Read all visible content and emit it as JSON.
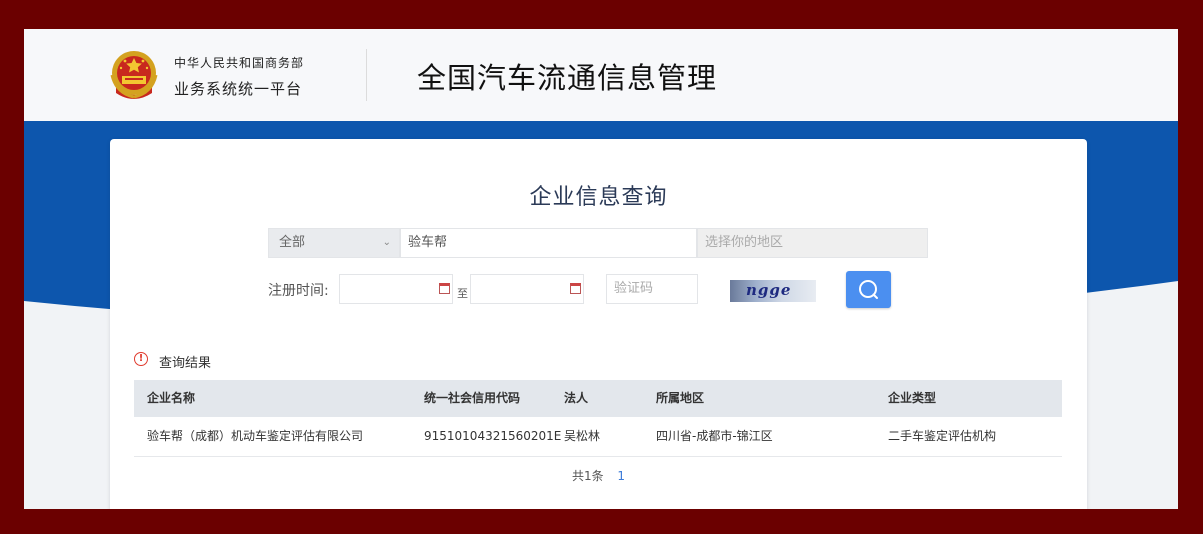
{
  "header": {
    "org_line1": "中华人民共和国商务部",
    "org_line2": "业务系统统一平台",
    "site_title": "全国汽车流通信息管理"
  },
  "search": {
    "title": "企业信息查询",
    "category_selected": "全部",
    "keyword_value": "验车帮",
    "region_placeholder": "选择你的地区",
    "reg_time_label": "注册时间:",
    "to_label": "至",
    "captcha_placeholder": "验证码",
    "captcha_text": "ngge"
  },
  "results": {
    "title": "查询结果",
    "columns": [
      "企业名称",
      "统一社会信用代码",
      "法人",
      "所属地区",
      "企业类型"
    ],
    "rows": [
      [
        "验车帮（成都）机动车鉴定评估有限公司",
        "91510104321560201E",
        "吴松林",
        "四川省-成都市-锦江区",
        "二手车鉴定评估机构"
      ]
    ]
  },
  "pagination": {
    "total_text": "共1条",
    "current_page": "1"
  },
  "colors": {
    "frame_border": "#6b0000",
    "band_blue": "#0d56ad",
    "search_button": "#4b8ff0",
    "alert_red": "#e03b2e"
  }
}
